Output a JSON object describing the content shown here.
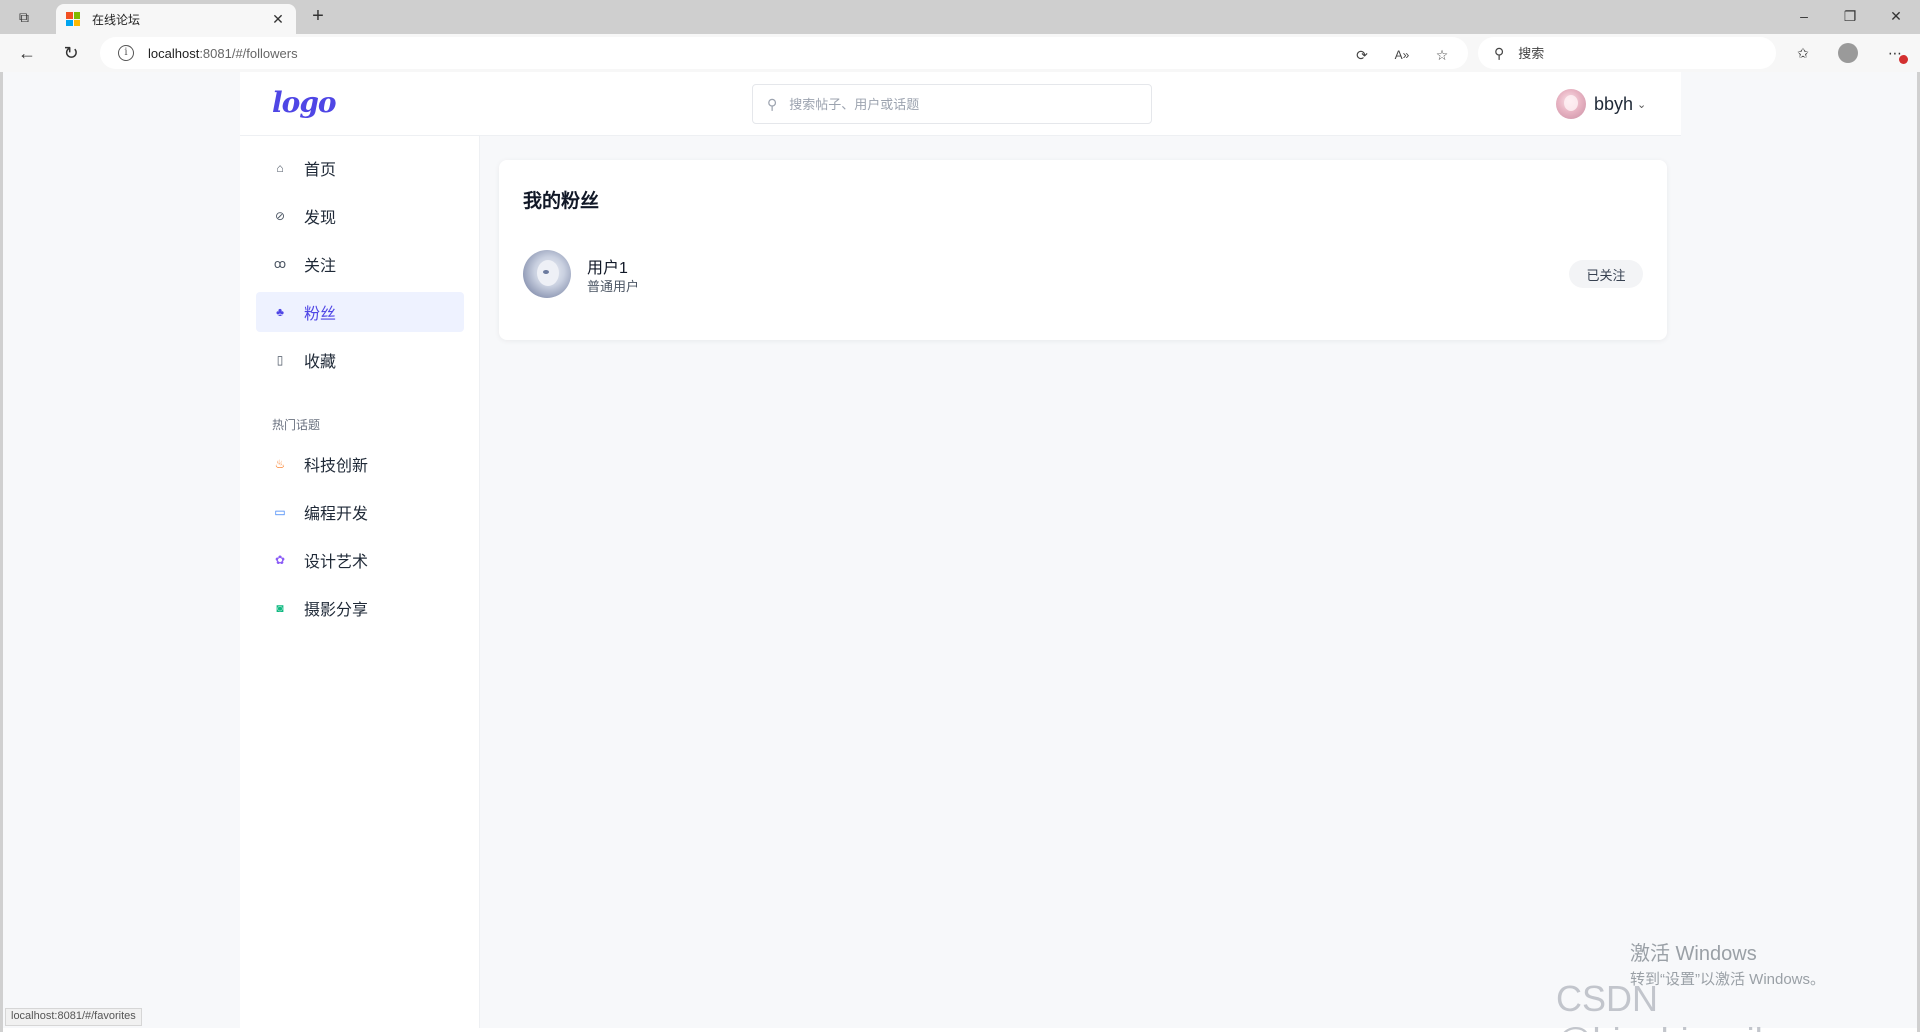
{
  "browser": {
    "tab_title": "在线论坛",
    "new_tab_icon": "plus-icon",
    "url_host": "localhost",
    "url_rest": ":8081/#/followers",
    "search_placeholder": "搜索",
    "status_url": "localhost:8081/#/favorites",
    "colors": {
      "tabstrip": "#cfcfcf",
      "toolbar": "#f7f7f7"
    }
  },
  "header": {
    "logo_text": "logo",
    "search_placeholder": "搜索帖子、用户或话题",
    "user_name": "bbyh"
  },
  "sidebar": {
    "items": [
      {
        "label": "首页",
        "icon": "home-icon"
      },
      {
        "label": "发现",
        "icon": "compass-icon"
      },
      {
        "label": "关注",
        "icon": "users-icon"
      },
      {
        "label": "粉丝",
        "icon": "fans-icon",
        "active": true
      },
      {
        "label": "收藏",
        "icon": "bookmark-icon"
      }
    ],
    "section_title": "热门话题",
    "topics": [
      {
        "label": "科技创新",
        "icon": "flame-icon",
        "color": "#f97316"
      },
      {
        "label": "编程开发",
        "icon": "laptop-icon",
        "color": "#3b82f6"
      },
      {
        "label": "设计艺术",
        "icon": "palette-icon",
        "color": "#8b5cf6"
      },
      {
        "label": "摄影分享",
        "icon": "camera-icon",
        "color": "#10b981"
      }
    ]
  },
  "main": {
    "title": "我的粉丝",
    "followers": [
      {
        "name": "用户1",
        "role": "普通用户",
        "button": "已关注"
      }
    ]
  },
  "overlay": {
    "activate_title": "激活 Windows",
    "activate_sub": "转到“设置”以激活 Windows。",
    "csdn_watermark": "CSDN @bingbingyihao"
  },
  "theme": {
    "accent": "#4f46e5",
    "active_bg": "#eef2ff",
    "page_bg": "#f7f8fa"
  }
}
